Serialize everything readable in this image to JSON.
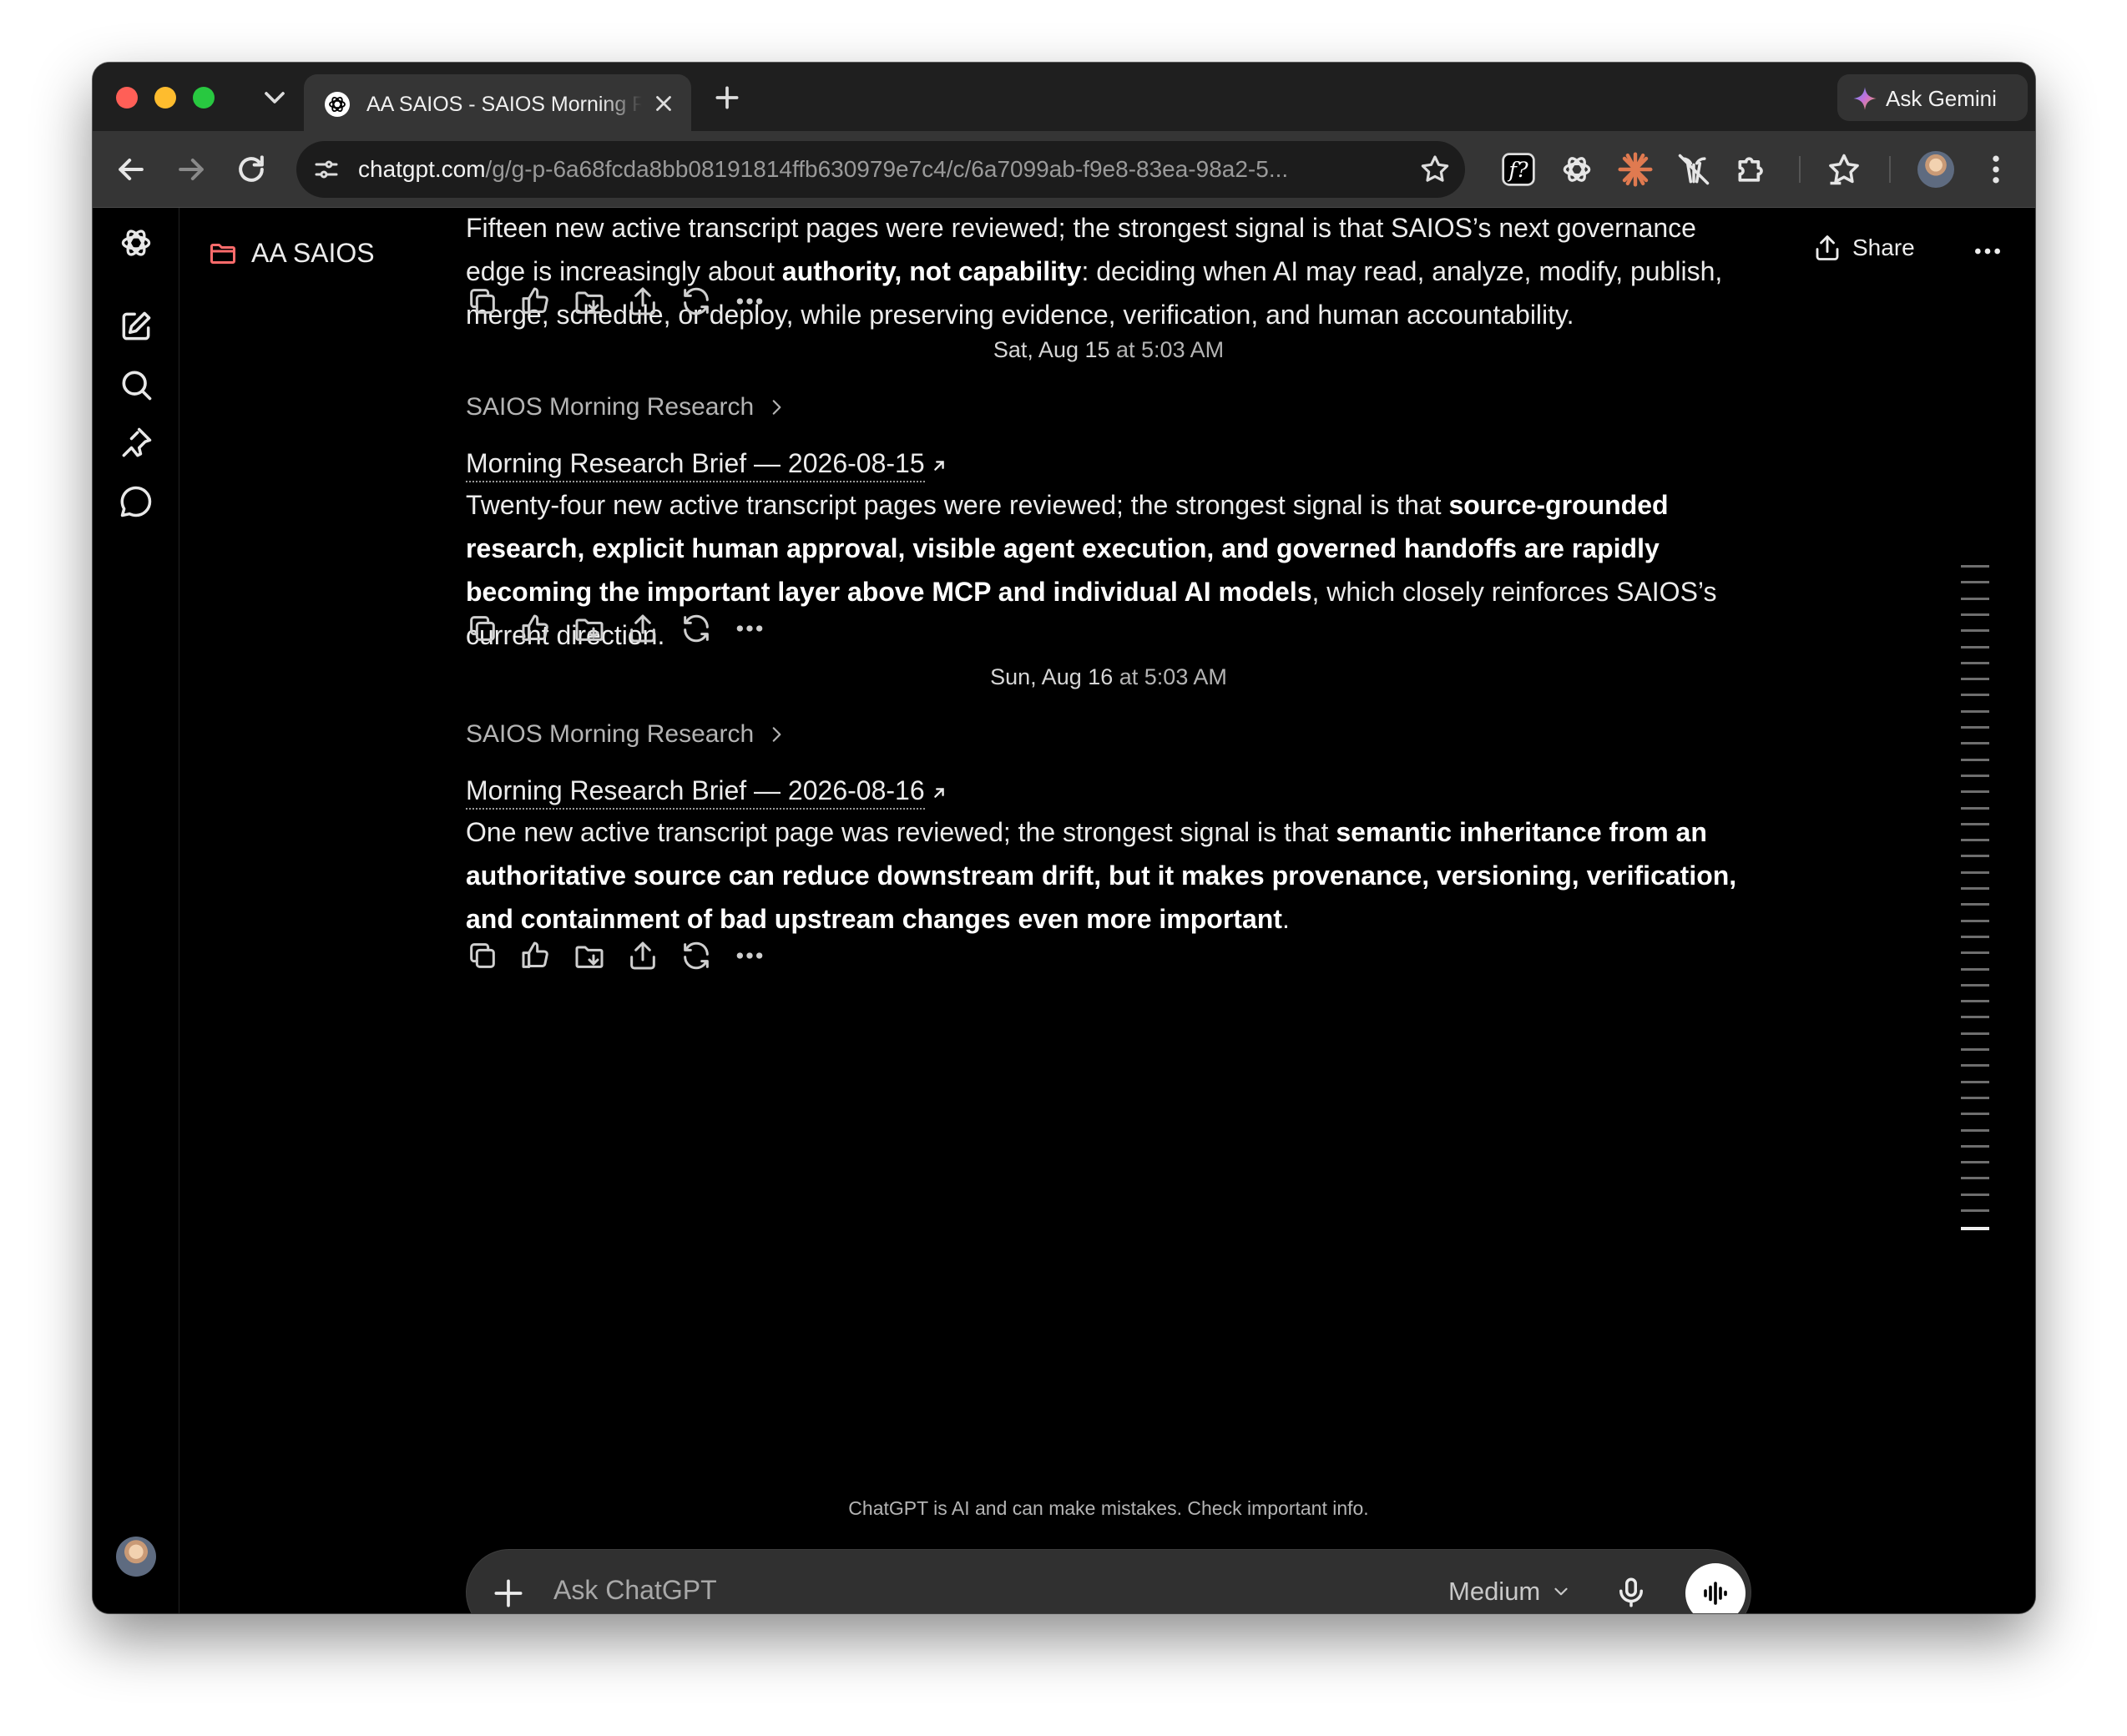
{
  "browser": {
    "tab_title": "AA SAIOS - SAIOS Morning Research",
    "url_host": "chatgpt.com",
    "url_path": "/g/g-p-6a68fcda8bb08191814ffb630979e7c4/c/6a7099ab-f9e8-83ea-98a2-5...",
    "gemini_label": "Ask Gemini"
  },
  "header": {
    "project_name": "AA SAIOS",
    "share_label": "Share"
  },
  "messages": [
    {
      "summary_parts": [
        {
          "text": "Fifteen new active transcript pages were reviewed; the strongest signal is that SAIOS’s next governance edge is increasingly about ",
          "bold": false
        },
        {
          "text": "authority, not capability",
          "bold": true
        },
        {
          "text": ": deciding when AI may read, analyze, modify, publish, merge, schedule, or deploy, while preserving evidence, verification, and human accountability.",
          "bold": false
        }
      ]
    },
    {
      "date": "Sat, Aug 15",
      "time": " at 5:03 AM",
      "gpt_name": "SAIOS Morning Research",
      "brief_title": "Morning Research Brief — 2026-08-15",
      "summary_parts": [
        {
          "text": "Twenty-four new active transcript pages were reviewed; the strongest signal is that ",
          "bold": false
        },
        {
          "text": "source-grounded research, explicit human approval, visible agent execution, and governed handoffs are rapidly becoming the important layer above MCP and individual AI models",
          "bold": true
        },
        {
          "text": ", which closely reinforces SAIOS’s current direction.",
          "bold": false
        }
      ]
    },
    {
      "date": "Sun, Aug 16",
      "time": " at 5:03 AM",
      "gpt_name": "SAIOS Morning Research",
      "brief_title": "Morning Research Brief — 2026-08-16",
      "summary_parts": [
        {
          "text": "One new active transcript page was reviewed; the strongest signal is that ",
          "bold": false
        },
        {
          "text": "semantic inheritance from an authoritative source can reduce downstream drift, but it makes provenance, versioning, verification, and containment of bad upstream changes even more important",
          "bold": true
        },
        {
          "text": ".",
          "bold": false
        }
      ]
    }
  ],
  "footer": {
    "disclaimer": "ChatGPT is AI and can make mistakes. Check important info."
  },
  "composer": {
    "placeholder": "Ask ChatGPT",
    "model": "Medium"
  },
  "colors": {
    "background": "#000000",
    "composer": "#303030",
    "project_folder": "#ff6b6b"
  }
}
